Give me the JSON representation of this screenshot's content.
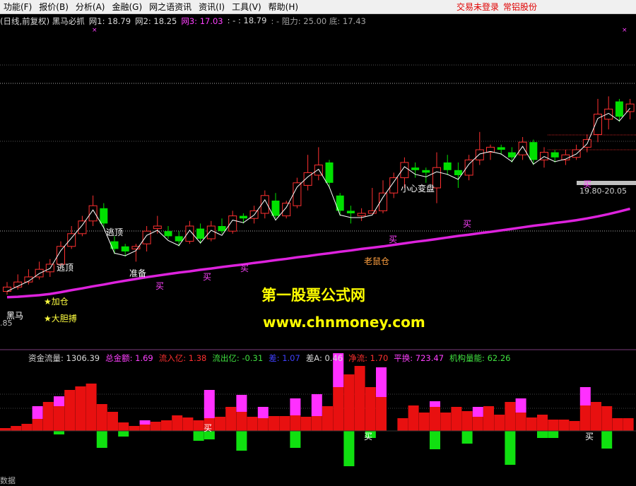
{
  "menu": {
    "items": [
      "功能(F)",
      "报价(B)",
      "分析(A)",
      "金融(G)",
      "网之语资讯",
      "资讯(I)",
      "工具(V)",
      "帮助(H)"
    ],
    "status_not_logged": "交易未登录",
    "broker": "常铝股份"
  },
  "info": {
    "title": "(日线,前复权) 黑马必抓",
    "net1": "网1: 18.79",
    "net2": "网2: 18.25",
    "net3": "网3: 17.03",
    "dash": ": - : 18.79",
    "resist": ": - 阻力: 25.00 底: 17.43"
  },
  "colors": {
    "up": "#ff3030",
    "down": "#00e000",
    "ma": "#dd22dd",
    "text_yellow": "#ffff40",
    "pink": "#ff40ff"
  },
  "annotations": {
    "escape_top_1": "逃顶",
    "escape_top_2": "逃顶",
    "prepare": "准备",
    "buy": "买",
    "add_position": "★加仓",
    "bold": "★大胆搏",
    "black_horse": "黑马",
    "small_change": "小心变盘",
    "old_rat": "老鼠仓",
    "price_range": "19.80-20.05",
    "left_value": ".85"
  },
  "watermark": {
    "line1": "第一股票公式网",
    "line2": "www.chnmoney.com"
  },
  "indicator": {
    "flow": "资金流量: 1306.39",
    "total": "总金额: 1.69",
    "inflow": "流入亿: 1.38",
    "outflow": "流出亿: -0.31",
    "diff": "差: 1.07",
    "diffA": "差A: 0.46",
    "net": "净流: 1.70",
    "turnover": "平换: 723.47",
    "inst": "机构量能: 62.26",
    "buy": "买",
    "footer": "数据"
  },
  "chart_data": {
    "type": "candlestick",
    "candles": [
      {
        "o": 17.43,
        "c": 17.6,
        "h": 17.8,
        "l": 17.3
      },
      {
        "o": 17.6,
        "c": 17.8,
        "h": 18.1,
        "l": 17.5
      },
      {
        "o": 17.8,
        "c": 18.0,
        "h": 18.3,
        "l": 17.7
      },
      {
        "o": 18.0,
        "c": 18.3,
        "h": 18.6,
        "l": 17.9
      },
      {
        "o": 18.2,
        "c": 18.5,
        "h": 18.7,
        "l": 18.0
      },
      {
        "o": 18.5,
        "c": 19.2,
        "h": 19.4,
        "l": 18.4
      },
      {
        "o": 19.2,
        "c": 19.7,
        "h": 20.0,
        "l": 19.1
      },
      {
        "o": 19.7,
        "c": 20.2,
        "h": 20.4,
        "l": 19.6
      },
      {
        "o": 20.2,
        "c": 20.8,
        "h": 21.2,
        "l": 20.0
      },
      {
        "o": 20.7,
        "c": 20.1,
        "h": 20.9,
        "l": 19.9
      },
      {
        "o": 19.4,
        "c": 19.1,
        "h": 19.6,
        "l": 18.9
      },
      {
        "o": 19.2,
        "c": 19.0,
        "h": 19.3,
        "l": 18.8
      },
      {
        "o": 19.1,
        "c": 19.2,
        "h": 19.3,
        "l": 18.6
      },
      {
        "o": 19.3,
        "c": 19.8,
        "h": 20.0,
        "l": 19.0
      },
      {
        "o": 19.9,
        "c": 20.0,
        "h": 20.4,
        "l": 19.7
      },
      {
        "o": 19.8,
        "c": 19.6,
        "h": 20.0,
        "l": 19.5
      },
      {
        "o": 19.6,
        "c": 19.4,
        "h": 19.8,
        "l": 19.2
      },
      {
        "o": 19.4,
        "c": 20.0,
        "h": 20.2,
        "l": 19.3
      },
      {
        "o": 19.9,
        "c": 19.5,
        "h": 20.1,
        "l": 19.3
      },
      {
        "o": 19.5,
        "c": 20.0,
        "h": 20.2,
        "l": 19.4
      },
      {
        "o": 20.0,
        "c": 19.8,
        "h": 20.3,
        "l": 19.7
      },
      {
        "o": 19.8,
        "c": 20.4,
        "h": 20.6,
        "l": 19.7
      },
      {
        "o": 20.4,
        "c": 20.3,
        "h": 20.5,
        "l": 20.1
      },
      {
        "o": 20.3,
        "c": 20.6,
        "h": 20.8,
        "l": 20.1
      },
      {
        "o": 20.5,
        "c": 21.2,
        "h": 21.4,
        "l": 20.3
      },
      {
        "o": 21.0,
        "c": 20.4,
        "h": 21.3,
        "l": 20.3
      },
      {
        "o": 20.4,
        "c": 20.9,
        "h": 21.0,
        "l": 20.3
      },
      {
        "o": 20.8,
        "c": 21.7,
        "h": 21.9,
        "l": 20.7
      },
      {
        "o": 21.6,
        "c": 22.1,
        "h": 22.8,
        "l": 21.4
      },
      {
        "o": 22.0,
        "c": 22.4,
        "h": 23.1,
        "l": 21.8
      },
      {
        "o": 22.5,
        "c": 21.7,
        "h": 22.6,
        "l": 21.5
      },
      {
        "o": 21.2,
        "c": 20.6,
        "h": 21.3,
        "l": 20.4
      },
      {
        "o": 20.6,
        "c": 20.5,
        "h": 20.8,
        "l": 20.1
      },
      {
        "o": 20.4,
        "c": 20.5,
        "h": 20.7,
        "l": 20.2
      },
      {
        "o": 20.5,
        "c": 20.6,
        "h": 21.5,
        "l": 20.5
      },
      {
        "o": 20.6,
        "c": 21.3,
        "h": 21.8,
        "l": 20.5
      },
      {
        "o": 21.3,
        "c": 21.9,
        "h": 22.1,
        "l": 21.1
      },
      {
        "o": 21.9,
        "c": 22.5,
        "h": 22.7,
        "l": 21.5
      },
      {
        "o": 22.3,
        "c": 22.2,
        "h": 22.5,
        "l": 21.9
      },
      {
        "o": 22.2,
        "c": 22.1,
        "h": 22.3,
        "l": 21.7
      },
      {
        "o": 21.5,
        "c": 22.3,
        "h": 22.9,
        "l": 20.9
      },
      {
        "o": 22.5,
        "c": 22.2,
        "h": 22.8,
        "l": 22.0
      },
      {
        "o": 22.2,
        "c": 22.0,
        "h": 22.5,
        "l": 21.5
      },
      {
        "o": 22.0,
        "c": 22.6,
        "h": 22.8,
        "l": 21.8
      },
      {
        "o": 22.6,
        "c": 23.0,
        "h": 23.7,
        "l": 22.4
      },
      {
        "o": 22.9,
        "c": 23.1,
        "h": 23.2,
        "l": 22.6
      },
      {
        "o": 23.1,
        "c": 23.0,
        "h": 23.2,
        "l": 22.8
      },
      {
        "o": 22.9,
        "c": 22.7,
        "h": 23.1,
        "l": 22.5
      },
      {
        "o": 22.8,
        "c": 23.3,
        "h": 23.5,
        "l": 22.6
      },
      {
        "o": 23.3,
        "c": 22.6,
        "h": 23.4,
        "l": 22.4
      },
      {
        "o": 22.6,
        "c": 22.9,
        "h": 23.1,
        "l": 22.3
      },
      {
        "o": 22.9,
        "c": 22.7,
        "h": 23.0,
        "l": 22.5
      },
      {
        "o": 22.6,
        "c": 22.8,
        "h": 23.0,
        "l": 22.4
      },
      {
        "o": 22.7,
        "c": 23.0,
        "h": 23.2,
        "l": 22.6
      },
      {
        "o": 23.1,
        "c": 23.4,
        "h": 23.6,
        "l": 22.9
      },
      {
        "o": 23.6,
        "c": 24.4,
        "h": 25.0,
        "l": 23.3
      },
      {
        "o": 24.2,
        "c": 24.6,
        "h": 25.1,
        "l": 23.8
      },
      {
        "o": 24.9,
        "c": 24.3,
        "h": 25.0,
        "l": 24.1
      },
      {
        "o": 24.5,
        "c": 24.8,
        "h": 25.0,
        "l": 24.2
      }
    ],
    "ma": [
      17.2,
      17.22,
      17.25,
      17.28,
      17.33,
      17.4,
      17.48,
      17.55,
      17.63,
      17.7,
      17.78,
      17.85,
      17.92,
      17.99,
      18.05,
      18.11,
      18.17,
      18.22,
      18.28,
      18.33,
      18.39,
      18.44,
      18.49,
      18.55,
      18.6,
      18.66,
      18.71,
      18.77,
      18.82,
      18.88,
      18.93,
      18.99,
      19.04,
      19.1,
      19.15,
      19.2,
      19.26,
      19.32,
      19.38,
      19.43,
      19.49,
      19.55,
      19.61,
      19.66,
      19.72,
      19.77,
      19.83,
      19.89,
      19.95,
      20.01,
      20.06,
      20.12,
      20.17,
      20.23,
      20.3,
      20.38,
      20.47,
      20.57,
      20.68
    ],
    "flow_red": [
      4,
      7,
      10,
      17,
      41,
      35,
      58,
      63,
      67,
      38,
      27,
      12,
      7,
      9,
      13,
      15,
      22,
      19,
      15,
      18,
      20,
      34,
      27,
      20,
      18,
      21,
      21,
      22,
      20,
      21,
      35,
      62,
      80,
      92,
      62,
      48,
      0,
      18,
      36,
      26,
      34,
      26,
      34,
      28,
      20,
      35,
      23,
      41,
      26,
      19,
      23,
      16,
      16,
      14,
      36,
      41,
      35,
      18,
      18
    ],
    "flow_pink": [
      0,
      0,
      0,
      18,
      0,
      14,
      0,
      0,
      0,
      0,
      0,
      0,
      0,
      6,
      0,
      0,
      0,
      0,
      0,
      40,
      0,
      0,
      24,
      0,
      16,
      0,
      0,
      24,
      0,
      31,
      0,
      48,
      0,
      0,
      0,
      42,
      0,
      0,
      0,
      0,
      8,
      0,
      0,
      0,
      14,
      0,
      0,
      0,
      20,
      0,
      0,
      0,
      0,
      0,
      26,
      0,
      0,
      0,
      0
    ],
    "flow_green": [
      0,
      0,
      0,
      0,
      0,
      5,
      0,
      0,
      0,
      24,
      0,
      8,
      0,
      0,
      0,
      0,
      0,
      0,
      14,
      12,
      0,
      0,
      28,
      0,
      0,
      0,
      0,
      24,
      0,
      0,
      0,
      0,
      50,
      0,
      10,
      0,
      0,
      0,
      0,
      0,
      26,
      0,
      0,
      18,
      0,
      0,
      0,
      48,
      0,
      0,
      10,
      10,
      0,
      0,
      0,
      0,
      25,
      0,
      0
    ]
  }
}
